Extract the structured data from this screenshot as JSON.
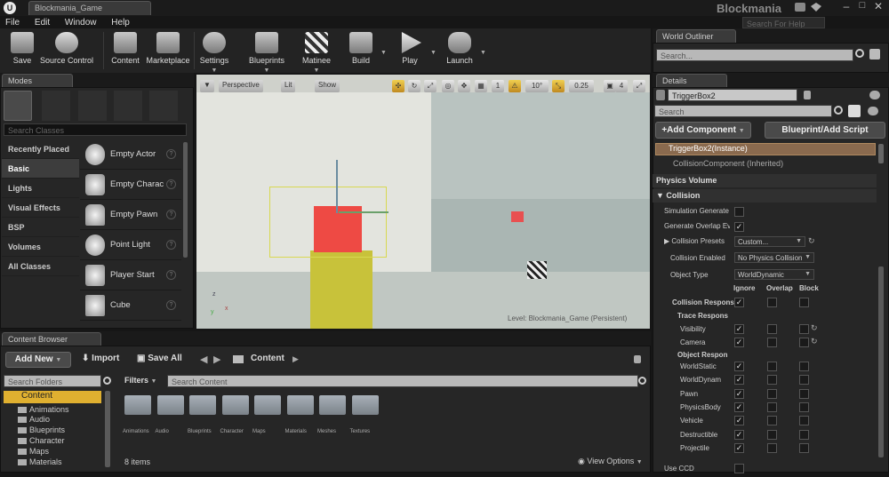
{
  "window": {
    "logo": "U",
    "tab_title": "Blockmania_Game",
    "app_title": "Blockmania",
    "search_help_placeholder": "Search For Help"
  },
  "menu": [
    "File",
    "Edit",
    "Window",
    "Help"
  ],
  "toolbar": [
    {
      "label": "Save",
      "icon": "save-icon"
    },
    {
      "label": "Source Control",
      "icon": "source-control-icon"
    },
    {
      "label": "Content",
      "icon": "content-icon"
    },
    {
      "label": "Marketplace",
      "icon": "marketplace-icon"
    },
    {
      "label": "Settings",
      "icon": "gear-icon"
    },
    {
      "label": "Blueprints",
      "icon": "blueprints-icon"
    },
    {
      "label": "Matinee",
      "icon": "clapper-icon"
    },
    {
      "label": "Build",
      "icon": "build-icon"
    },
    {
      "label": "Play",
      "icon": "play-icon"
    },
    {
      "label": "Launch",
      "icon": "gamepad-icon"
    }
  ],
  "modes": {
    "tab": "Modes",
    "search_placeholder": "Search Classes",
    "categories": [
      "Recently Placed",
      "Basic",
      "Lights",
      "Visual Effects",
      "BSP",
      "Volumes",
      "All Classes"
    ],
    "selected_category": "Basic",
    "items": [
      "Empty Actor",
      "Empty Charac",
      "Empty Pawn",
      "Point Light",
      "Player Start",
      "Cube"
    ],
    "help_glyph": "?"
  },
  "viewport": {
    "perspective": "Perspective",
    "lit": "Lit",
    "show": "Show",
    "grid_snap": "1",
    "rot_snap": "10°",
    "scale_snap": "0.25",
    "camera_speed": "4",
    "level_text": "Level:  Blockmania_Game (Persistent)",
    "axis_x": "x",
    "axis_y": "y",
    "axis_z": "z"
  },
  "world_outliner": {
    "tab": "World Outliner",
    "search_placeholder": "Search..."
  },
  "details": {
    "tab": "Details",
    "name_value": "TriggerBox2",
    "search_placeholder": "Search",
    "add_component": "+Add Component",
    "blueprint_script": "Blueprint/Add Script",
    "instance": "TriggerBox2(Instance)",
    "component": "CollisionComponent (Inherited)",
    "physics_volume": "Physics Volume",
    "collision_section": "Collision",
    "sim_generates": "Simulation Generate",
    "gen_overlap": "Generate Overlap Ev",
    "collision_presets": "Collision Presets",
    "presets_value": "Custom...",
    "collision_enabled": "Collision Enabled",
    "collision_enabled_value": "No Physics Collision",
    "object_type": "Object Type",
    "object_type_value": "WorldDynamic",
    "col_headers": [
      "Ignore",
      "Overlap",
      "Block"
    ],
    "collision_responses": "Collision Respons",
    "trace_responses": "Trace Respons",
    "trace_rows": [
      "Visibility",
      "Camera"
    ],
    "object_responses": "Object Respon",
    "object_rows": [
      "WorldStatic",
      "WorldDynam",
      "Pawn",
      "PhysicsBody",
      "Vehicle",
      "Destructible",
      "Projectile"
    ],
    "use_ccd": "Use CCD",
    "check": "✓"
  },
  "content_browser": {
    "tab": "Content Browser",
    "add_new": "Add New",
    "import": "Import",
    "save_all": "Save All",
    "path": "Content",
    "search_folders": "Search Folders",
    "filters": "Filters",
    "search_content": "Search Content",
    "tree": [
      "Content",
      "Animations",
      "Audio",
      "Blueprints",
      "Character",
      "Maps",
      "Materials"
    ],
    "folders": [
      "Animations",
      "Audio",
      "Blueprints",
      "Character",
      "Maps",
      "Materials",
      "Meshes",
      "Textures"
    ],
    "items_count": "8 items",
    "view_options": "View Options"
  }
}
